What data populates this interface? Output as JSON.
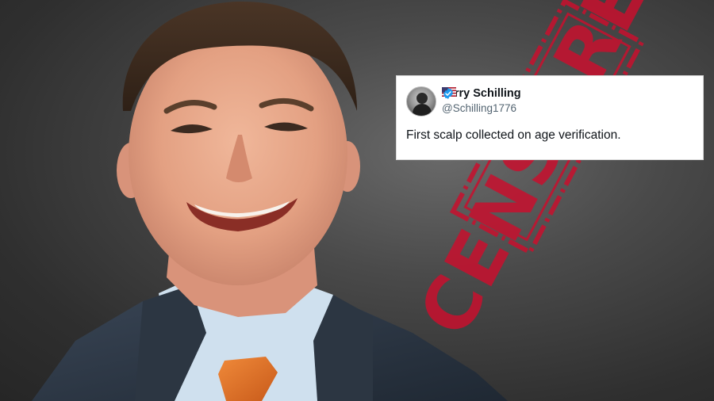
{
  "photo": {
    "subject": "smiling-man-in-suit"
  },
  "stamp": {
    "text": "CENSORED",
    "color": "#c8102e"
  },
  "tweet": {
    "display_name": "Terry Schilling",
    "handle": "@Schilling1776",
    "text": "First scalp collected on age verification.",
    "flag_icon": "us-flag-icon",
    "verified_icon": "verified-badge-icon",
    "verified_color": "#1d9bf0"
  }
}
